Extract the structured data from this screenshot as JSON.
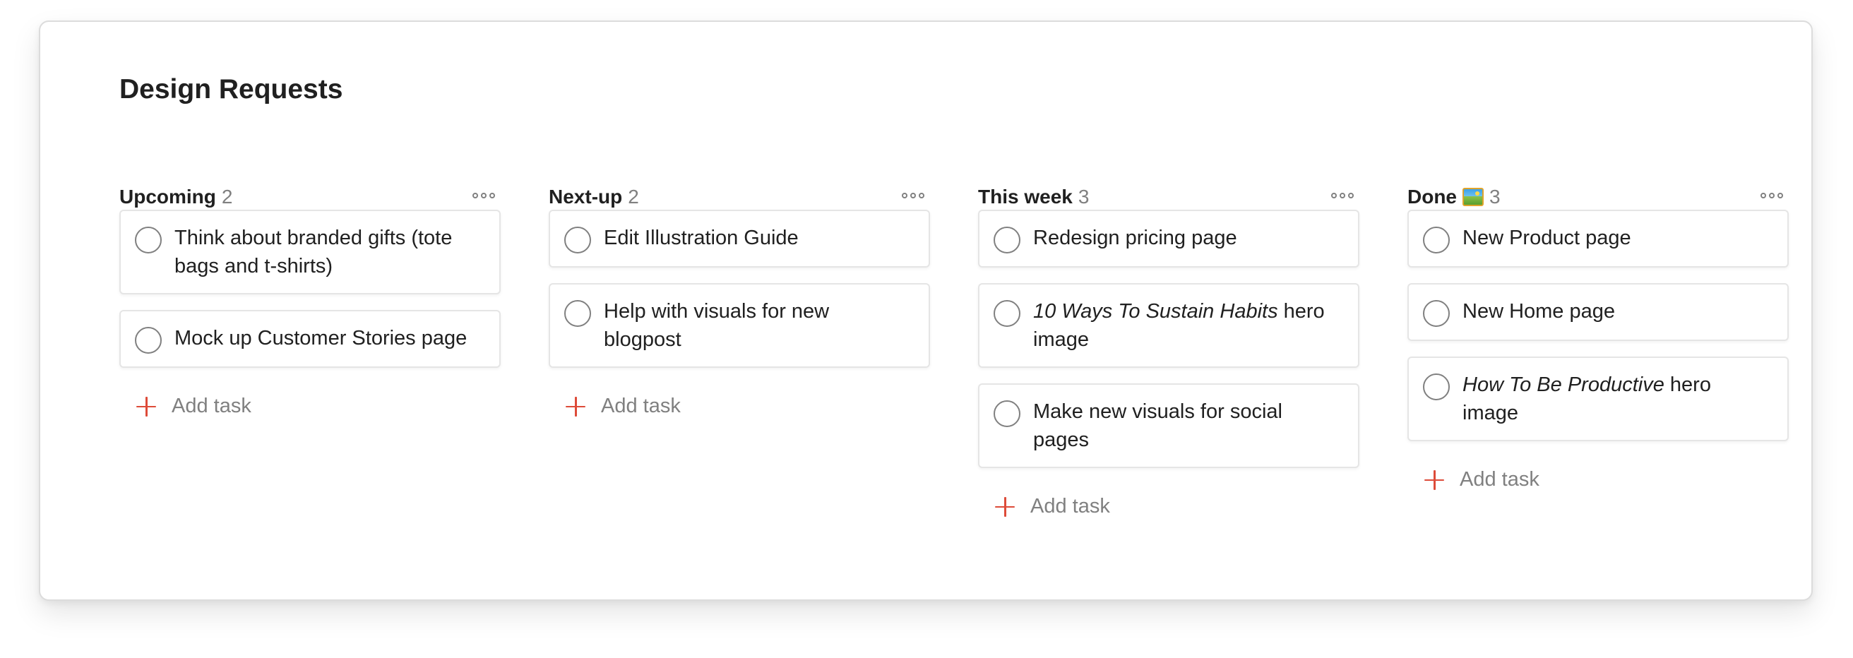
{
  "project": {
    "title": "Design Requests"
  },
  "add_task_label": "Add task",
  "columns": [
    {
      "name": "Upcoming",
      "count": "2",
      "tasks": [
        {
          "text": "Think about branded gifts (tote bags and t-shirts)"
        },
        {
          "text": "Mock up Customer Stories page"
        }
      ]
    },
    {
      "name": "Next-up",
      "count": "2",
      "tasks": [
        {
          "text": "Edit Illustration Guide"
        },
        {
          "text": "Help with visuals for new blogpost"
        }
      ]
    },
    {
      "name": "This week",
      "count": "3",
      "tasks": [
        {
          "text": "Redesign pricing page"
        },
        {
          "italic": "10 Ways To Sustain Habits",
          "rest": " hero image"
        },
        {
          "text": "Make new visuals for social pages"
        }
      ]
    },
    {
      "name": "Done",
      "emoji_icon": "framed-picture-icon",
      "count": "3",
      "tasks": [
        {
          "text": "New Product page"
        },
        {
          "text": "New Home page"
        },
        {
          "italic": "How To Be Productive",
          "rest": " hero image"
        }
      ]
    }
  ],
  "colors": {
    "accent": "#dd4b39",
    "text": "#202020",
    "muted": "#808080",
    "border": "#e5e5e5"
  }
}
